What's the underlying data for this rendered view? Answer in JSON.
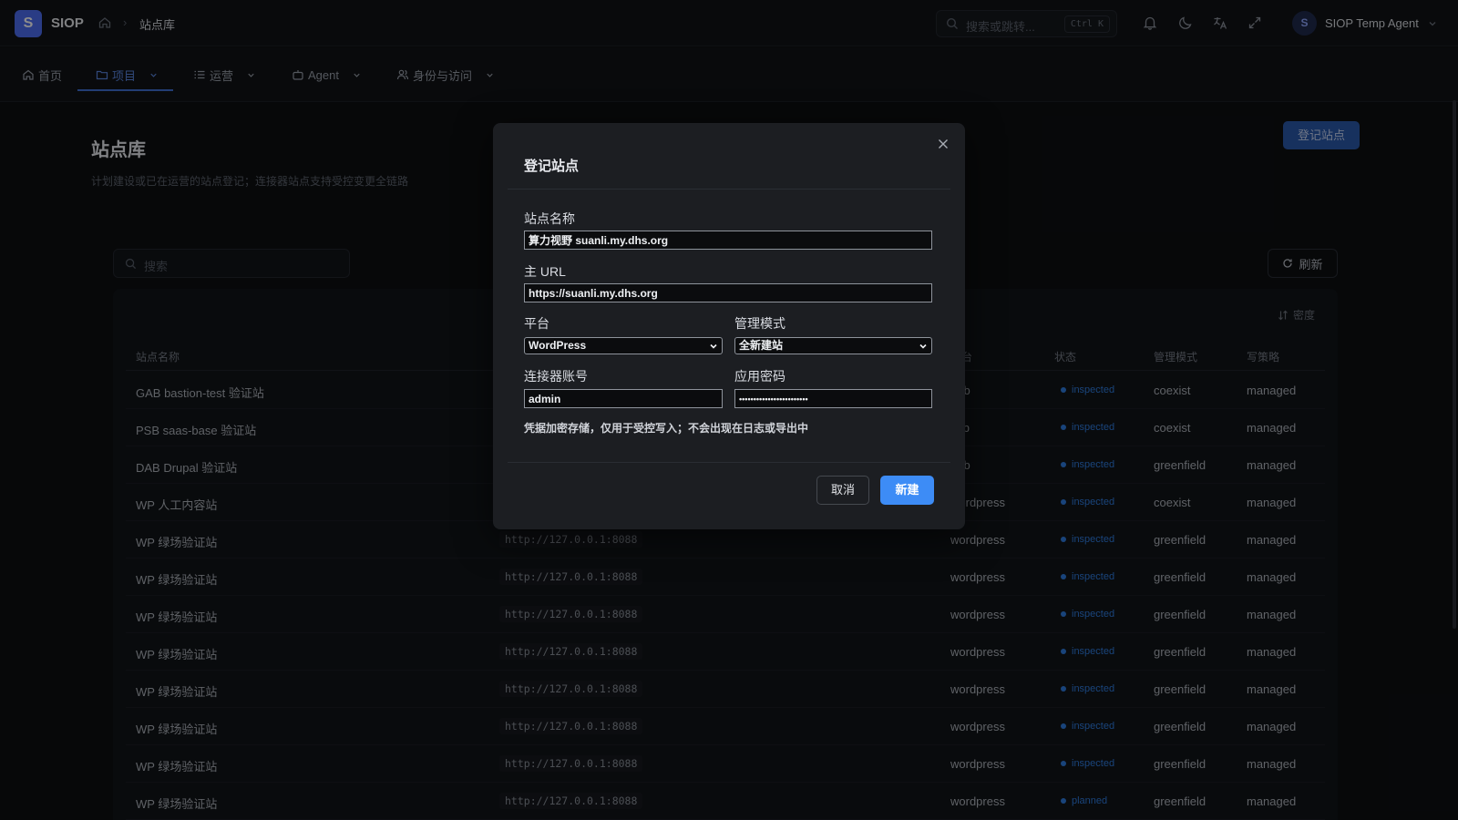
{
  "app": {
    "logo_letter": "S",
    "name": "SIOP"
  },
  "breadcrumb": {
    "current": "站点库"
  },
  "search": {
    "placeholder": "搜索或跳转...",
    "shortcut": "Ctrl K"
  },
  "user": {
    "avatar_letter": "S",
    "name": "SIOP Temp Agent"
  },
  "nav": [
    {
      "label": "首页",
      "icon": "home-icon"
    },
    {
      "label": "项目",
      "icon": "folder-icon",
      "active": true
    },
    {
      "label": "运营",
      "icon": "list-icon"
    },
    {
      "label": "Agent",
      "icon": "robot-icon"
    },
    {
      "label": "身份与访问",
      "icon": "users-icon"
    }
  ],
  "page": {
    "title": "站点库",
    "subtitle": "计划建设或已在运营的站点登记；连接器站点支持受控变更全链路",
    "register_button": "登记站点",
    "search_placeholder": "搜索",
    "refresh_label": "刷新",
    "density_label": "密度"
  },
  "table": {
    "headers": [
      "站点名称",
      "平台",
      "状态",
      "管理模式",
      "写策略"
    ],
    "rows": [
      {
        "name": "GAB bastion-test 验证站",
        "url": "",
        "platform": "gab",
        "status": "inspected",
        "mode": "coexist",
        "policy": "managed"
      },
      {
        "name": "PSB saas-base 验证站",
        "url": "",
        "platform": "psb",
        "status": "inspected",
        "mode": "coexist",
        "policy": "managed"
      },
      {
        "name": "DAB Drupal 验证站",
        "url": "",
        "platform": "dab",
        "status": "inspected",
        "mode": "greenfield",
        "policy": "managed"
      },
      {
        "name": "WP 人工内容站",
        "url": "",
        "platform": "wordpress",
        "status": "inspected",
        "mode": "coexist",
        "policy": "managed"
      },
      {
        "name": "WP 绿场验证站",
        "url": "http://127.0.0.1:8088",
        "platform": "wordpress",
        "status": "inspected",
        "mode": "greenfield",
        "policy": "managed"
      },
      {
        "name": "WP 绿场验证站",
        "url": "http://127.0.0.1:8088",
        "platform": "wordpress",
        "status": "inspected",
        "mode": "greenfield",
        "policy": "managed"
      },
      {
        "name": "WP 绿场验证站",
        "url": "http://127.0.0.1:8088",
        "platform": "wordpress",
        "status": "inspected",
        "mode": "greenfield",
        "policy": "managed"
      },
      {
        "name": "WP 绿场验证站",
        "url": "http://127.0.0.1:8088",
        "platform": "wordpress",
        "status": "inspected",
        "mode": "greenfield",
        "policy": "managed"
      },
      {
        "name": "WP 绿场验证站",
        "url": "http://127.0.0.1:8088",
        "platform": "wordpress",
        "status": "inspected",
        "mode": "greenfield",
        "policy": "managed"
      },
      {
        "name": "WP 绿场验证站",
        "url": "http://127.0.0.1:8088",
        "platform": "wordpress",
        "status": "inspected",
        "mode": "greenfield",
        "policy": "managed"
      },
      {
        "name": "WP 绿场验证站",
        "url": "http://127.0.0.1:8088",
        "platform": "wordpress",
        "status": "inspected",
        "mode": "greenfield",
        "policy": "managed"
      },
      {
        "name": "WP 绿场验证站",
        "url": "http://127.0.0.1:8088",
        "platform": "wordpress",
        "status": "planned",
        "mode": "greenfield",
        "policy": "managed"
      }
    ]
  },
  "status_colors": {
    "inspected": "#2f7de1",
    "planned": "#2f7de1"
  },
  "modal": {
    "title": "登记站点",
    "site_name_label": "站点名称",
    "site_name_value": "算力视野 suanli.my.dhs.org",
    "url_label": "主 URL",
    "url_value": "https://suanli.my.dhs.org",
    "platform_label": "平台",
    "platform_value": "WordPress",
    "mode_label": "管理模式",
    "mode_value": "全新建站",
    "account_label": "连接器账号",
    "account_value": "admin",
    "password_label": "应用密码",
    "password_value": "••••••••••••••••••••••••",
    "hint": "凭据加密存储，仅用于受控写入；不会出现在日志或导出中",
    "cancel_label": "取消",
    "create_label": "新建"
  }
}
